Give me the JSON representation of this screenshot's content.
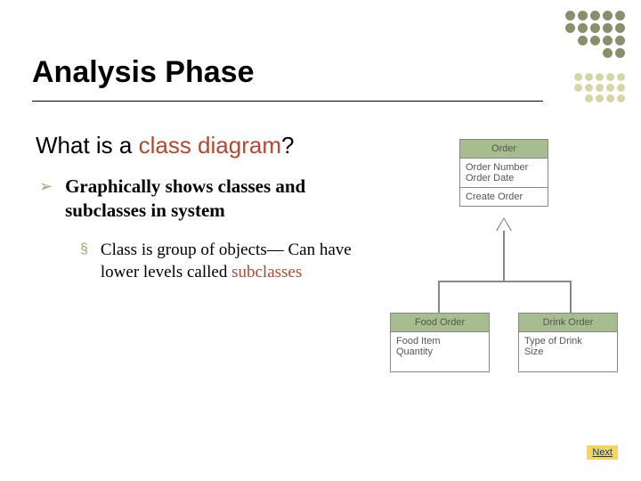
{
  "title": "Analysis Phase",
  "subtitle_pre": "What is a ",
  "subtitle_hl": "class diagram",
  "subtitle_post": "?",
  "bullet1": "Graphically shows classes and subclasses in system",
  "bullet2_pre": "Class is group of objects— Can have lower levels called ",
  "bullet2_hl": "subclasses",
  "diagram": {
    "parent": {
      "name": "Order",
      "attrs": [
        "Order Number",
        "Order Date"
      ],
      "ops": [
        "Create Order"
      ]
    },
    "child1": {
      "name": "Food Order",
      "attrs": [
        "Food Item",
        "Quantity"
      ]
    },
    "child2": {
      "name": "Drink Order",
      "attrs": [
        "Type of Drink",
        "Size"
      ]
    }
  },
  "next_label": "Next",
  "dots_top": {
    "rows": [
      [
        "#8a8f6a",
        "#8a8f6a",
        "#8a8f6a",
        "#8a8f6a",
        "#8a8f6a"
      ],
      [
        "#8a8f6a",
        "#8a8f6a",
        "#8a8f6a",
        "#8a8f6a",
        "#8a8f6a"
      ],
      [
        "#8a8f6a",
        "#8a8f6a",
        "#8a8f6a",
        "#8a8f6a"
      ],
      [
        "#8a8f6a",
        "#8a8f6a"
      ]
    ]
  },
  "dots_mid": {
    "rows": [
      [
        "#d4d7a5",
        "#d4d7a5",
        "#d4d7a5",
        "#d4d7a5",
        "#d4d7a5"
      ],
      [
        "#d4d7a5",
        "#d4d7a5",
        "#d4d7a5",
        "#d4d7a5",
        "#d4d7a5"
      ],
      [
        "#d4d7a5",
        "#d4d7a5",
        "#d4d7a5",
        "#d4d7a5"
      ]
    ]
  }
}
